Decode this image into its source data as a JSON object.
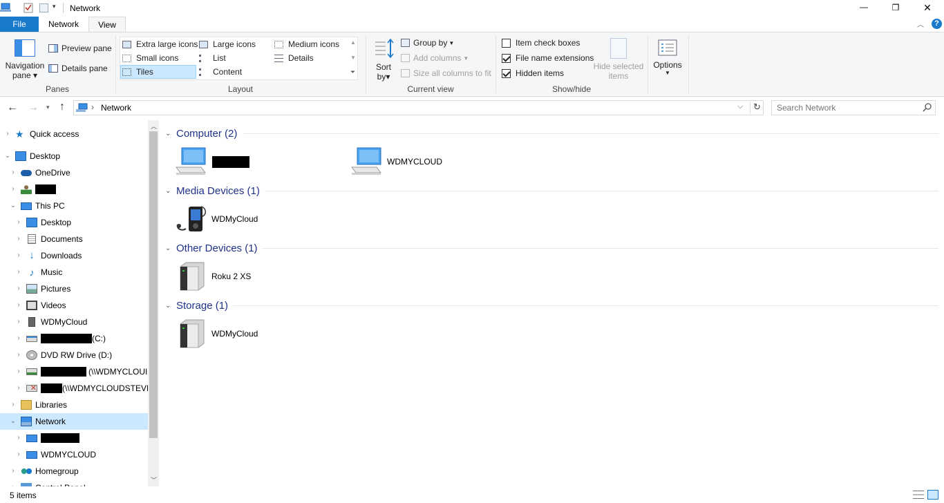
{
  "window": {
    "title": "Network",
    "controls": {
      "minimize": "—",
      "maximize": "❐",
      "close": "✕"
    }
  },
  "tabs": {
    "file": "File",
    "network": "Network",
    "view": "View",
    "help": "?"
  },
  "ribbon": {
    "panes": {
      "label": "Panes",
      "navigation_pane_1": "Navigation",
      "navigation_pane_2": "pane",
      "preview_pane": "Preview pane",
      "details_pane": "Details pane"
    },
    "layout": {
      "label": "Layout",
      "extra_large_icons": "Extra large icons",
      "large_icons": "Large icons",
      "medium_icons": "Medium icons",
      "small_icons": "Small icons",
      "list": "List",
      "details": "Details",
      "tiles": "Tiles",
      "content": "Content"
    },
    "current_view": {
      "label": "Current view",
      "sort_by_1": "Sort",
      "sort_by_2": "by",
      "group_by": "Group by",
      "add_columns": "Add columns",
      "size_columns": "Size all columns to fit"
    },
    "show_hide": {
      "label": "Show/hide",
      "item_check_boxes": "Item check boxes",
      "file_name_extensions": "File name extensions",
      "hidden_items": "Hidden items",
      "hide_selected_1": "Hide selected",
      "hide_selected_2": "items",
      "states": {
        "item_check_boxes": false,
        "file_name_extensions": true,
        "hidden_items": true
      }
    },
    "options": {
      "label": "Options"
    }
  },
  "address": {
    "path": "Network",
    "separator": "›",
    "search_placeholder": "Search Network"
  },
  "nav": {
    "quick_access": "Quick access",
    "desktop": "Desktop",
    "onedrive": "OneDrive",
    "this_pc": "This PC",
    "pc_desktop": "Desktop",
    "documents": "Documents",
    "downloads": "Downloads",
    "music": "Music",
    "pictures": "Pictures",
    "videos": "Videos",
    "wdmycloud": "WDMyCloud",
    "drive_c_suffix": "(C:)",
    "dvd": "DVD RW Drive (D:)",
    "share1_suffix": "(\\\\WDMYCLOUI",
    "share2_suffix": "(\\\\WDMYCLOUDSTEVE",
    "libraries": "Libraries",
    "network": "Network",
    "net_wdmycloud": "WDMYCLOUD",
    "homegroup": "Homegroup",
    "control_panel": "Control Panel"
  },
  "groups": [
    {
      "title": "Computer (2)",
      "items": [
        "",
        "WDMYCLOUD"
      ]
    },
    {
      "title": "Media Devices (1)",
      "items": [
        "WDMyCloud"
      ]
    },
    {
      "title": "Other Devices (1)",
      "items": [
        "Roku 2 XS"
      ]
    },
    {
      "title": "Storage (1)",
      "items": [
        "WDMyCloud"
      ]
    }
  ],
  "status": {
    "count": "5 items"
  },
  "colors": {
    "accent": "#1979ca",
    "selected": "#cce8ff",
    "group_header": "#1e3287"
  }
}
